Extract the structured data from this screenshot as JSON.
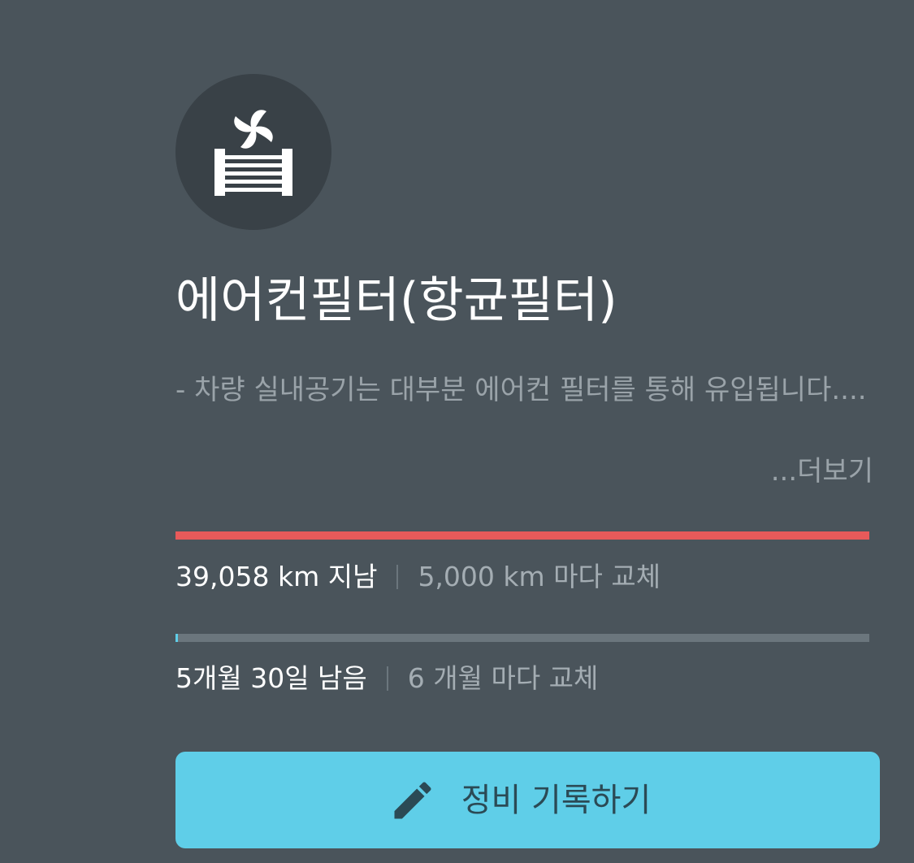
{
  "item": {
    "icon": "air-filter-fan-icon",
    "title": "에어컨필터(항균필터)",
    "description": "- 차량 실내공기는 대부분 에어컨 필터를 통해 유입됩니다....",
    "more_label": "...더보기"
  },
  "distance": {
    "progress": 1.0,
    "color": "#e85a5a",
    "elapsed_label": "39,058 km 지남",
    "interval_label": "5,000 km 마다 교체"
  },
  "period": {
    "progress": 0.003,
    "color": "#5fcee8",
    "remaining_label": "5개월 30일 남음",
    "interval_label": "6 개월 마다 교체"
  },
  "action": {
    "icon": "pencil-icon",
    "record_label": "정비 기록하기"
  },
  "colors": {
    "background": "#4a545b",
    "accent": "#5fcee8",
    "overdue": "#e85a5a"
  }
}
